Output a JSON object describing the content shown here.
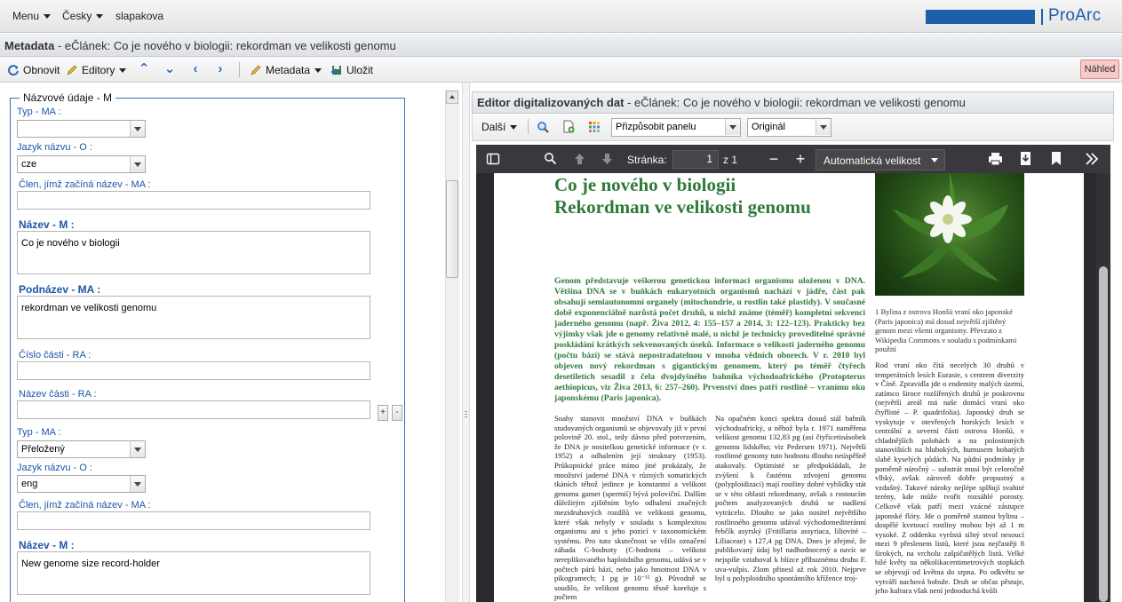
{
  "topbar": {
    "menu_label": "Menu",
    "language_label": "Česky",
    "user_label": "slapakova",
    "brand": "ProArc"
  },
  "titlebar": {
    "prefix": "Metadata",
    "rest": " - eČlánek: Co je nového v biologii: rekordman ve velikosti genomu"
  },
  "toolbar": {
    "refresh_label": "Obnovit",
    "editors_label": "Editory",
    "metadata_label": "Metadata",
    "save_label": "Uložit",
    "preview_label": "Náhled"
  },
  "form": {
    "legend": "Názvové údaje - M",
    "type1_label": "Typ - MA :",
    "type1_value": "",
    "lang1_label": "Jazyk názvu - O :",
    "lang1_value": "cze",
    "nonsort1_label": "Člen, jímž začíná název - MA :",
    "nonsort1_value": "",
    "title1_label": "Název - M :",
    "title1_value": "Co je nového v biologii",
    "subtitle1_label": "Podnázev - MA :",
    "subtitle1_value": "rekordman ve velikosti genomu",
    "partnum1_label": "Číslo části - RA :",
    "partname1_label": "Název části - RA :",
    "add_label": "+",
    "remove_label": "-",
    "type2_label": "Typ - MA :",
    "type2_value": "Přeložený",
    "lang2_label": "Jazyk názvu - O :",
    "lang2_value": "eng",
    "nonsort2_label": "Člen, jímž začíná název - MA :",
    "title2_label": "Název - M :",
    "title2_value": "New genome size record-holder"
  },
  "editor": {
    "title_bold": "Editor digitalizovaných dat",
    "title_rest": " - eČlánek: Co je nového v biologii: rekordman ve velikosti genomu",
    "next_label": "Další",
    "fit_select": "Přizpůsobit panelu",
    "original_select": "Originál"
  },
  "pdf": {
    "page_label": "Stránka:",
    "page_value": "1",
    "page_total": "z 1",
    "zoom_value": "Automatická velikost",
    "title_line1": "Co je nového v biologii",
    "title_line2": "Rekordman ve velikosti genomu",
    "intro": "Genom představuje veškerou genetickou informaci organismu uloženou v DNA. Většina DNA se v buňkách eukaryotních organismů nachází v jádře, část pak obsahují semiautonomní organely (mitochondrie, u rostlin také plastidy). V současné době exponenciálně narůstá počet druhů, u nichž známe (téměř) kompletní sekvenci jaderného genomu (např. Živa 2012, 4: 155–157 a 2014, 3: 122–123). Prakticky bez výjimky však jde o genomy relativně malé, u nichž je technicky proveditelné správné poskládání krátkých sekvenovaných úseků. Informace o velikosti jaderného genomu (počtu bází) se stává nepostradatelnou v mnoha vědních oborech. V r. 2010 byl objeven nový rekordman s gigantickým genomem, který po téměř čtyřech desetiletích sesadil z čela dvojdyšného bahníka východoafrického (Protopterus aethiopicus, viz Živa 2013, 6: 257–260). Prvenství dnes patří rostlině – vranímu oku japonskému (Paris japonica).",
    "col1": "Snahy stanovit množství DNA v buňkách studovaných organismů se objevovaly již v první polovině 20. stol., tedy dávno před potvrzením, že DNA je nositelkou genetické informace (v r. 1952) a odhalením její struktury (1953). Průkopnické práce mimo jiné prokázaly, že množství jaderné DNA v různých somatických tkáních téhož jedince je konstantní a velikost genomu gamet (spermií) bývá poloviční. Dalším důležitým zjištěním bylo odhalení značných mezidruhových rozdílů ve velikosti genomu, které však nebyly v souladu s komplexitou organismu ani s jeho pozicí v taxonomickém systému. Pro tuto skutečnost se vžilo označení záhada C-hodnoty (C-hodnota – velikost nereplikovaného haploidního genomu, udává se v počtech párů bází, nebo jako hmotnost DNA v pikogramech; 1 pg je 10⁻¹² g). Původně se soudilo, že velikost genomu těsně koreluje s počtem",
    "col2": "Na opačném konci spektra dosud stál bahník východoafrický, u něhož byla r. 1971 naměřena velikost genomu 132,83 pg (asi čtyřicetinásobek genomu lidského; viz Pedersen 1971). Největší rostlinné genomy tuto hodnotu dlouho neúspěšně atakovaly. Optimisté se předpokládali, že zvýšení k častému zdvojení genomu (polyploidizaci) mají rostliny dobré vyhlídky stát se v této oblasti rekordmany, avšak s rostoucím počtem analyzovaných druhů se nadšení vytrácelo. Dlouho se jako nositel největšího rostlinného genomu udával východomediteránní řebčík asyrský (Fritillaria assyriaca, liliovité – Liliaceae) s 127,4 pg DNA. Dnes je zřejmé, že publikovaný údaj byl nadhodnocený a navíc se nejspíše vztahoval k blízce příbuznému druhu F. uva-vulpis. Zlom přinesl až rok 2010. Nejprve byl u polyploidního spontánního křížence troj-",
    "caption": "1 Bylina z ostrova Honšú vraní oko japonské (Paris japonica) má dosud největší zjištěný genom mezi všemi organismy. Převzato z Wikipedia Commons v souladu s podmínkami použití",
    "col3": "Rod vraní oko čítá necelých 30 druhů v temperátních lesích Eurasie, s centrem diverzity v Číně. Zpravidla jde o endemity malých území, zatímco široce rozšířených druhů je poskrovnu (největší areál má naše domácí vraní oko čtyřlisté – P. quadrifolia). Japonský druh se vyskytuje v otevřených horských lesích v centrální a severní části ostrova Honšú, v chladnějších polohách a na polostinných stanovištích na hlubokých, humusem bohatých slabě kyselých půdách. Na půdní podmínky je poměrně náročný – substrát musí být celoročně vlhký, avšak zároveň dobře propustný a vzdušný. Takové nároky nejlépe splňují svahité terény, kde může tvořit rozsáhlé porosty. Celkově však patří mezi vzácné zástupce japonské flóry. Jde o poměrně statnou bylinu – dospělé kvetoucí rostliny mohou být až 1 m vysoké. Z oddenku vyrůstá silný stvol nesoucí mezi 9 přeslenem listů, které jsou nejčastěji 8 širokých, na vrcholu zašpičatělých listů. Velké bílé květy na několikacentimetrových stopkách se objevují od května do srpna. Po odkvětu se vytváří nachová bobule. Druh se občas pěstuje, jeho kultura však není jednoduchá kvůli"
  }
}
